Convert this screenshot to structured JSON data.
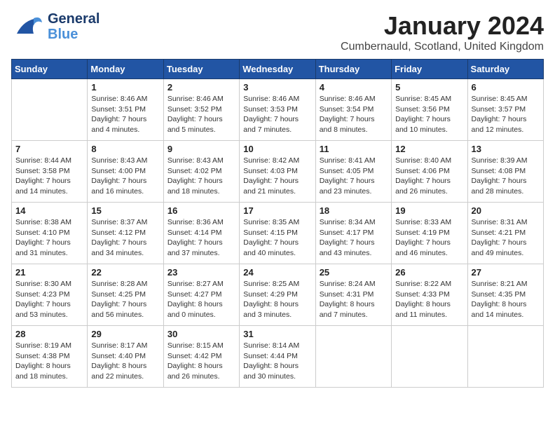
{
  "logo": {
    "line1": "General",
    "line2": "Blue"
  },
  "title": "January 2024",
  "location": "Cumbernauld, Scotland, United Kingdom",
  "days_of_week": [
    "Sunday",
    "Monday",
    "Tuesday",
    "Wednesday",
    "Thursday",
    "Friday",
    "Saturday"
  ],
  "weeks": [
    [
      {
        "day": "",
        "sunrise": "",
        "sunset": "",
        "daylight": ""
      },
      {
        "day": "1",
        "sunrise": "Sunrise: 8:46 AM",
        "sunset": "Sunset: 3:51 PM",
        "daylight": "Daylight: 7 hours and 4 minutes."
      },
      {
        "day": "2",
        "sunrise": "Sunrise: 8:46 AM",
        "sunset": "Sunset: 3:52 PM",
        "daylight": "Daylight: 7 hours and 5 minutes."
      },
      {
        "day": "3",
        "sunrise": "Sunrise: 8:46 AM",
        "sunset": "Sunset: 3:53 PM",
        "daylight": "Daylight: 7 hours and 7 minutes."
      },
      {
        "day": "4",
        "sunrise": "Sunrise: 8:46 AM",
        "sunset": "Sunset: 3:54 PM",
        "daylight": "Daylight: 7 hours and 8 minutes."
      },
      {
        "day": "5",
        "sunrise": "Sunrise: 8:45 AM",
        "sunset": "Sunset: 3:56 PM",
        "daylight": "Daylight: 7 hours and 10 minutes."
      },
      {
        "day": "6",
        "sunrise": "Sunrise: 8:45 AM",
        "sunset": "Sunset: 3:57 PM",
        "daylight": "Daylight: 7 hours and 12 minutes."
      }
    ],
    [
      {
        "day": "7",
        "sunrise": "Sunrise: 8:44 AM",
        "sunset": "Sunset: 3:58 PM",
        "daylight": "Daylight: 7 hours and 14 minutes."
      },
      {
        "day": "8",
        "sunrise": "Sunrise: 8:43 AM",
        "sunset": "Sunset: 4:00 PM",
        "daylight": "Daylight: 7 hours and 16 minutes."
      },
      {
        "day": "9",
        "sunrise": "Sunrise: 8:43 AM",
        "sunset": "Sunset: 4:02 PM",
        "daylight": "Daylight: 7 hours and 18 minutes."
      },
      {
        "day": "10",
        "sunrise": "Sunrise: 8:42 AM",
        "sunset": "Sunset: 4:03 PM",
        "daylight": "Daylight: 7 hours and 21 minutes."
      },
      {
        "day": "11",
        "sunrise": "Sunrise: 8:41 AM",
        "sunset": "Sunset: 4:05 PM",
        "daylight": "Daylight: 7 hours and 23 minutes."
      },
      {
        "day": "12",
        "sunrise": "Sunrise: 8:40 AM",
        "sunset": "Sunset: 4:06 PM",
        "daylight": "Daylight: 7 hours and 26 minutes."
      },
      {
        "day": "13",
        "sunrise": "Sunrise: 8:39 AM",
        "sunset": "Sunset: 4:08 PM",
        "daylight": "Daylight: 7 hours and 28 minutes."
      }
    ],
    [
      {
        "day": "14",
        "sunrise": "Sunrise: 8:38 AM",
        "sunset": "Sunset: 4:10 PM",
        "daylight": "Daylight: 7 hours and 31 minutes."
      },
      {
        "day": "15",
        "sunrise": "Sunrise: 8:37 AM",
        "sunset": "Sunset: 4:12 PM",
        "daylight": "Daylight: 7 hours and 34 minutes."
      },
      {
        "day": "16",
        "sunrise": "Sunrise: 8:36 AM",
        "sunset": "Sunset: 4:14 PM",
        "daylight": "Daylight: 7 hours and 37 minutes."
      },
      {
        "day": "17",
        "sunrise": "Sunrise: 8:35 AM",
        "sunset": "Sunset: 4:15 PM",
        "daylight": "Daylight: 7 hours and 40 minutes."
      },
      {
        "day": "18",
        "sunrise": "Sunrise: 8:34 AM",
        "sunset": "Sunset: 4:17 PM",
        "daylight": "Daylight: 7 hours and 43 minutes."
      },
      {
        "day": "19",
        "sunrise": "Sunrise: 8:33 AM",
        "sunset": "Sunset: 4:19 PM",
        "daylight": "Daylight: 7 hours and 46 minutes."
      },
      {
        "day": "20",
        "sunrise": "Sunrise: 8:31 AM",
        "sunset": "Sunset: 4:21 PM",
        "daylight": "Daylight: 7 hours and 49 minutes."
      }
    ],
    [
      {
        "day": "21",
        "sunrise": "Sunrise: 8:30 AM",
        "sunset": "Sunset: 4:23 PM",
        "daylight": "Daylight: 7 hours and 53 minutes."
      },
      {
        "day": "22",
        "sunrise": "Sunrise: 8:28 AM",
        "sunset": "Sunset: 4:25 PM",
        "daylight": "Daylight: 7 hours and 56 minutes."
      },
      {
        "day": "23",
        "sunrise": "Sunrise: 8:27 AM",
        "sunset": "Sunset: 4:27 PM",
        "daylight": "Daylight: 8 hours and 0 minutes."
      },
      {
        "day": "24",
        "sunrise": "Sunrise: 8:25 AM",
        "sunset": "Sunset: 4:29 PM",
        "daylight": "Daylight: 8 hours and 3 minutes."
      },
      {
        "day": "25",
        "sunrise": "Sunrise: 8:24 AM",
        "sunset": "Sunset: 4:31 PM",
        "daylight": "Daylight: 8 hours and 7 minutes."
      },
      {
        "day": "26",
        "sunrise": "Sunrise: 8:22 AM",
        "sunset": "Sunset: 4:33 PM",
        "daylight": "Daylight: 8 hours and 11 minutes."
      },
      {
        "day": "27",
        "sunrise": "Sunrise: 8:21 AM",
        "sunset": "Sunset: 4:35 PM",
        "daylight": "Daylight: 8 hours and 14 minutes."
      }
    ],
    [
      {
        "day": "28",
        "sunrise": "Sunrise: 8:19 AM",
        "sunset": "Sunset: 4:38 PM",
        "daylight": "Daylight: 8 hours and 18 minutes."
      },
      {
        "day": "29",
        "sunrise": "Sunrise: 8:17 AM",
        "sunset": "Sunset: 4:40 PM",
        "daylight": "Daylight: 8 hours and 22 minutes."
      },
      {
        "day": "30",
        "sunrise": "Sunrise: 8:15 AM",
        "sunset": "Sunset: 4:42 PM",
        "daylight": "Daylight: 8 hours and 26 minutes."
      },
      {
        "day": "31",
        "sunrise": "Sunrise: 8:14 AM",
        "sunset": "Sunset: 4:44 PM",
        "daylight": "Daylight: 8 hours and 30 minutes."
      },
      {
        "day": "",
        "sunrise": "",
        "sunset": "",
        "daylight": ""
      },
      {
        "day": "",
        "sunrise": "",
        "sunset": "",
        "daylight": ""
      },
      {
        "day": "",
        "sunrise": "",
        "sunset": "",
        "daylight": ""
      }
    ]
  ]
}
